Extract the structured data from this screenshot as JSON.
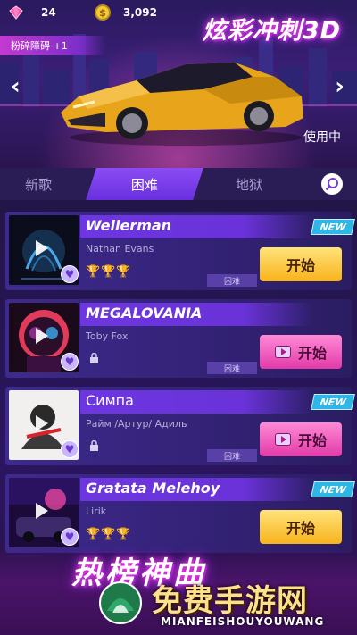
{
  "header": {
    "gems": "24",
    "coins": "3,092",
    "coin_symbol": "$",
    "game_title": "炫彩冲刺3D",
    "perk_label": "粉碎障碍 +1",
    "car_status": "使用中",
    "prev_arrow": "‹",
    "next_arrow": "›",
    "car_color": "#e8a51b"
  },
  "tabs": [
    {
      "label": "新歌",
      "active": false
    },
    {
      "label": "困难",
      "active": true
    },
    {
      "label": "地狱",
      "active": false
    }
  ],
  "songs": [
    {
      "title": "Wellerman",
      "artist": "Nathan Evans",
      "difficulty": "困难",
      "badge": "NEW",
      "start_label": "开始",
      "button_style": "gold",
      "trophies": "🏆🏆🏆",
      "locked": false
    },
    {
      "title": "MEGALOVANIA",
      "artist": "Toby Fox",
      "difficulty": "困难",
      "badge": "",
      "start_label": "开始",
      "button_style": "pink",
      "trophies": "",
      "locked": true
    },
    {
      "title": "Симпа",
      "artist": "Райм /Артур/ Адиль",
      "difficulty": "困难",
      "badge": "NEW",
      "start_label": "开始",
      "button_style": "pink",
      "trophies": "",
      "locked": true
    },
    {
      "title": "Gratata Melehoy",
      "artist": "Lirik",
      "difficulty": "",
      "badge": "NEW",
      "start_label": "开始",
      "button_style": "gold",
      "trophies": "🏆🏆🏆",
      "locked": false
    }
  ],
  "banner": {
    "title": "热榜神曲"
  },
  "watermark": {
    "name": "免费手游网",
    "url_text": "MIANFEISHOUYOUWANG"
  },
  "colors": {
    "accent_purple": "#6a30e0",
    "new_badge": "#2db6e6",
    "gold_button": "#f7b31c",
    "pink_button": "#e23aa8"
  }
}
